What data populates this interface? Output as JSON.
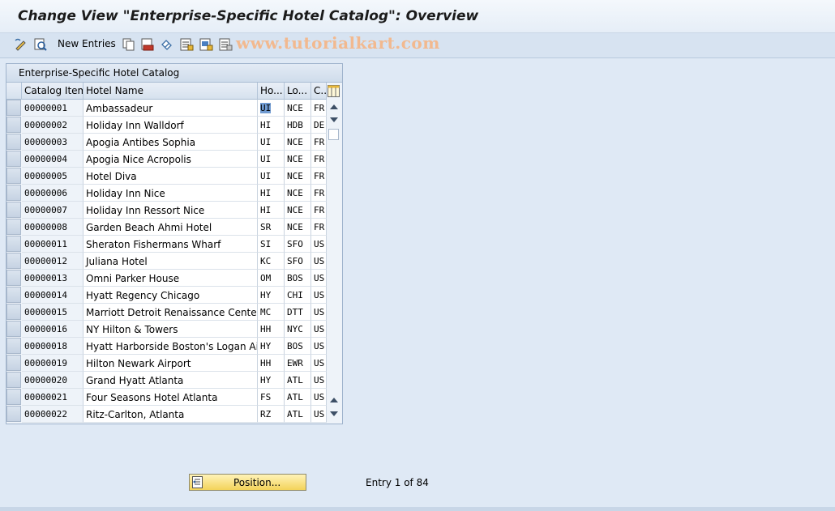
{
  "window": {
    "title": "Change View \"Enterprise-Specific Hotel Catalog\": Overview"
  },
  "toolbar": {
    "new_entries_label": "New Entries",
    "watermark": "www.tutorialkart.com",
    "icons": [
      "change-display-icon",
      "details-icon",
      "copy-icon",
      "delete-icon",
      "undo-icon",
      "select-all-icon",
      "select-block-icon",
      "deselect-all-icon"
    ]
  },
  "table": {
    "title": "Enterprise-Specific Hotel Catalog",
    "columns": [
      "Catalog Item",
      "Hotel Name",
      "Ho...",
      "Lo...",
      "C..."
    ],
    "rows": [
      {
        "item": "00000001",
        "name": "Ambassadeur",
        "ho": "UI",
        "lo": "NCE",
        "c": "FR"
      },
      {
        "item": "00000002",
        "name": "Holiday Inn Walldorf",
        "ho": "HI",
        "lo": "HDB",
        "c": "DE"
      },
      {
        "item": "00000003",
        "name": "Apogia Antibes Sophia",
        "ho": "UI",
        "lo": "NCE",
        "c": "FR"
      },
      {
        "item": "00000004",
        "name": "Apogia Nice Acropolis",
        "ho": "UI",
        "lo": "NCE",
        "c": "FR"
      },
      {
        "item": "00000005",
        "name": "Hotel Diva",
        "ho": "UI",
        "lo": "NCE",
        "c": "FR"
      },
      {
        "item": "00000006",
        "name": "Holiday Inn Nice",
        "ho": "HI",
        "lo": "NCE",
        "c": "FR"
      },
      {
        "item": "00000007",
        "name": "Holiday Inn Ressort Nice",
        "ho": "HI",
        "lo": "NCE",
        "c": "FR"
      },
      {
        "item": "00000008",
        "name": "Garden Beach Ahmi Hotel",
        "ho": "SR",
        "lo": "NCE",
        "c": "FR"
      },
      {
        "item": "00000011",
        "name": "Sheraton Fishermans Wharf",
        "ho": "SI",
        "lo": "SFO",
        "c": "US"
      },
      {
        "item": "00000012",
        "name": "Juliana Hotel",
        "ho": "KC",
        "lo": "SFO",
        "c": "US"
      },
      {
        "item": "00000013",
        "name": "Omni Parker House",
        "ho": "OM",
        "lo": "BOS",
        "c": "US"
      },
      {
        "item": "00000014",
        "name": "Hyatt Regency Chicago",
        "ho": "HY",
        "lo": "CHI",
        "c": "US"
      },
      {
        "item": "00000015",
        "name": "Marriott Detroit Renaissance Center",
        "ho": "MC",
        "lo": "DTT",
        "c": "US"
      },
      {
        "item": "00000016",
        "name": "NY Hilton & Towers",
        "ho": "HH",
        "lo": "NYC",
        "c": "US"
      },
      {
        "item": "00000018",
        "name": "Hyatt Harborside Boston's Logan Airp...",
        "ho": "HY",
        "lo": "BOS",
        "c": "US"
      },
      {
        "item": "00000019",
        "name": "Hilton Newark Airport",
        "ho": "HH",
        "lo": "EWR",
        "c": "US"
      },
      {
        "item": "00000020",
        "name": "Grand Hyatt Atlanta",
        "ho": "HY",
        "lo": "ATL",
        "c": "US"
      },
      {
        "item": "00000021",
        "name": "Four Seasons Hotel Atlanta",
        "ho": "FS",
        "lo": "ATL",
        "c": "US"
      },
      {
        "item": "00000022",
        "name": "Ritz-Carlton, Atlanta",
        "ho": "RZ",
        "lo": "ATL",
        "c": "US"
      }
    ]
  },
  "footer": {
    "position_label": "Position...",
    "entry_text": "Entry 1 of 84"
  },
  "colors": {
    "accent_button": "#f3d35a",
    "selection": "#6f9ad1",
    "background": "#dfe9f5"
  }
}
